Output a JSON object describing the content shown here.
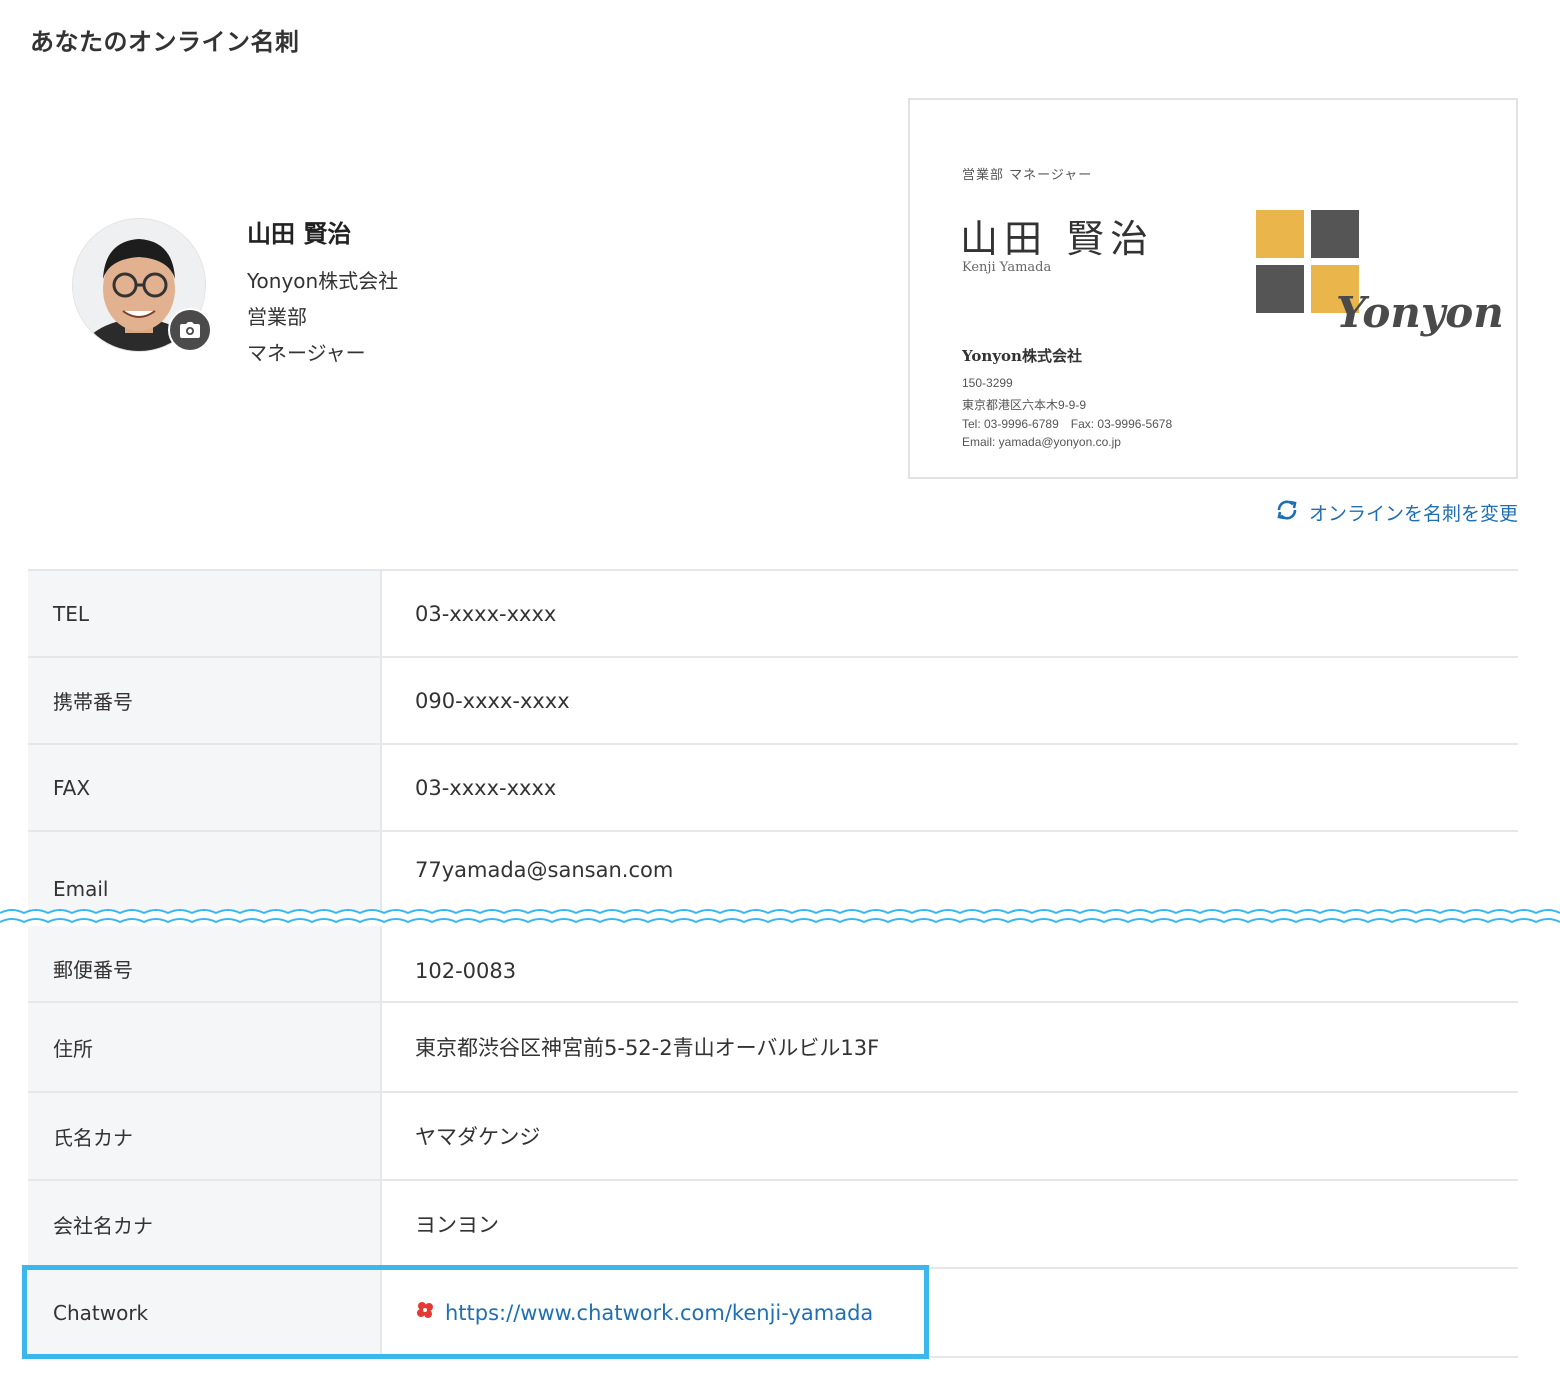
{
  "page": {
    "title": "あなたのオンライン名刺"
  },
  "profile": {
    "name": "山田 賢治",
    "company": "Yonyon株式会社",
    "department": "営業部",
    "position": "マネージャー"
  },
  "card": {
    "department_title": "営業部 マネージャー",
    "name": "山田 賢治",
    "name_roman": "Kenji Yamada",
    "company": "Yonyon株式会社",
    "postal": "150-3299",
    "address": "東京都港区六本木9-9-9",
    "tel_fax": "Tel: 03-9996-6789　Fax: 03-9996-5678",
    "email": "Email: yamada@yonyon.co.jp",
    "logo_text": "Yonyon",
    "logo_colors": [
      "#eab54b",
      "#555555",
      "#555555",
      "#eab54b"
    ]
  },
  "actions": {
    "change_card_label": "オンラインを名刺を変更"
  },
  "details": [
    {
      "label": "TEL",
      "value": "03-xxxx-xxxx"
    },
    {
      "label": "携帯番号",
      "value": "090-xxxx-xxxx"
    },
    {
      "label": "FAX",
      "value": "03-xxxx-xxxx"
    },
    {
      "label": "Email",
      "value": "77yamada@sansan.com"
    },
    {
      "label": "郵便番号",
      "value": "102-0083"
    },
    {
      "label": "住所",
      "value": "東京都渋谷区神宮前5-52-2青山オーバルビル13F"
    },
    {
      "label": "氏名カナ",
      "value": "ヤマダケンジ"
    },
    {
      "label": "会社名カナ",
      "value": "ヨンヨン"
    },
    {
      "label": "Chatwork",
      "value": "https://www.chatwork.com/kenji-yamada"
    }
  ],
  "colors": {
    "link": "#1e6fb3",
    "highlight": "#3bb7ee",
    "label_bg": "#f5f6f8"
  }
}
